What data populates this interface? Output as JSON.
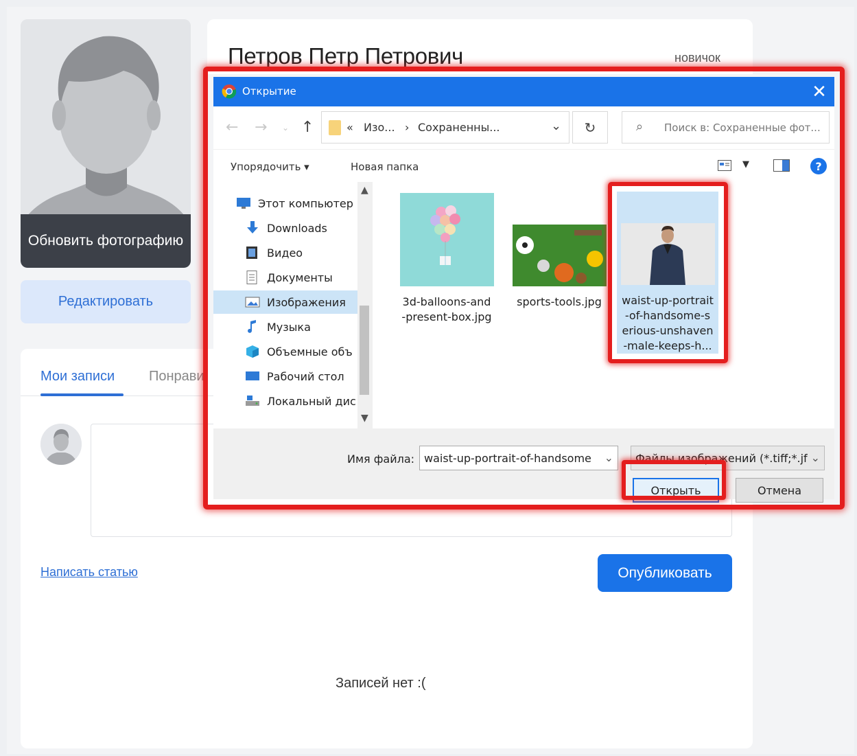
{
  "profile": {
    "name": "Петров Петр Петрович",
    "status": "новичок",
    "update_photo_label": "Обновить фотографию",
    "edit_label": "Редактировать"
  },
  "feed": {
    "tabs": [
      {
        "label": "Мои записи",
        "active": true
      },
      {
        "label": "Понрави"
      }
    ],
    "write_article_label": "Написать статью",
    "publish_label": "Опубликовать",
    "empty_label": "Записей нет :("
  },
  "dialog": {
    "title": "Открытие",
    "close_glyph": "✕",
    "breadcrumbs": [
      "«",
      "Изо...",
      "›",
      "Сохраненны..."
    ],
    "search_placeholder": "Поиск в: Сохраненные фот...",
    "organize_label": "Упорядочить ▾",
    "new_folder_label": "Новая папка",
    "help_glyph": "?",
    "sidebar": [
      {
        "label": "Этот компьютер",
        "icon": "computer-icon"
      },
      {
        "label": "Downloads",
        "icon": "download-icon"
      },
      {
        "label": "Видео",
        "icon": "video-icon"
      },
      {
        "label": "Документы",
        "icon": "document-icon"
      },
      {
        "label": "Изображения",
        "icon": "pictures-icon",
        "selected": true
      },
      {
        "label": "Музыка",
        "icon": "music-icon"
      },
      {
        "label": "Объемные объ",
        "icon": "3d-objects-icon"
      },
      {
        "label": "Рабочий стол",
        "icon": "desktop-icon"
      },
      {
        "label": "Локальный дис",
        "icon": "disk-icon"
      }
    ],
    "files": [
      {
        "name_lines": [
          "3d-balloons-and",
          "-present-box.jpg"
        ]
      },
      {
        "name_lines": [
          "sports-tools.jpg"
        ]
      },
      {
        "name_lines": [
          "waist-up-portrait",
          "-of-handsome-s",
          "erious-unshaven",
          "-male-keeps-h..."
        ],
        "selected": true
      }
    ],
    "filename_label": "Имя файла:",
    "filename_value": "waist-up-portrait-of-handsome",
    "filetype_value": "Файлы изображений (*.tiff;*.jf",
    "open_label": "Открыть",
    "cancel_label": "Отмена"
  },
  "colors": {
    "accent": "#1a73e8",
    "highlight": "#e41e1e",
    "selection": "#cce4f7"
  }
}
